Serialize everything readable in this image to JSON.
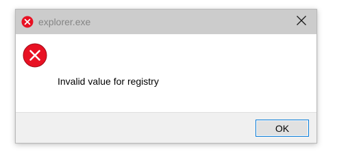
{
  "window": {
    "title": "explorer.exe",
    "icon": "error-icon",
    "close_icon": "close-icon"
  },
  "body": {
    "icon": "error-icon",
    "message": "Invalid value for registry"
  },
  "footer": {
    "ok_label": "OK"
  },
  "colors": {
    "error_red": "#e81123",
    "titlebar_bg": "#cccccc",
    "footer_bg": "#f0f0f0",
    "button_border": "#0078d7",
    "button_bg": "#e1e1e1"
  }
}
